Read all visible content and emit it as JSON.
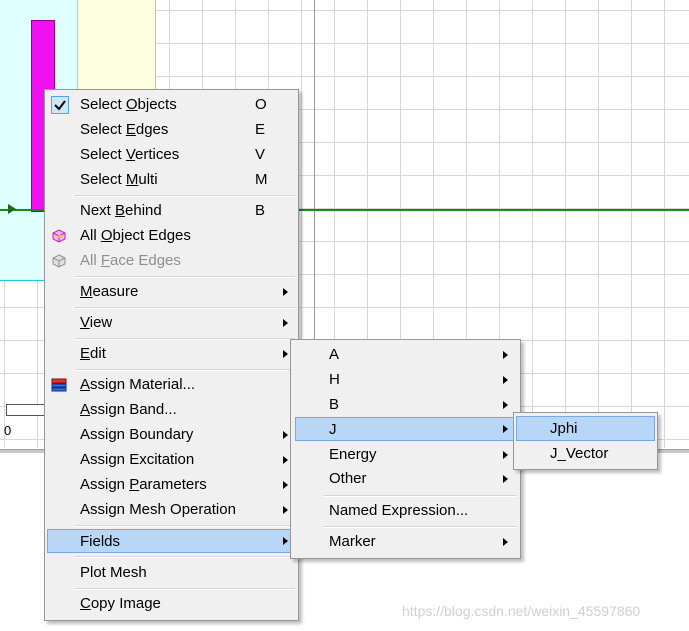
{
  "canvas": {
    "ruler_zero": "0"
  },
  "main_menu": {
    "items": [
      {
        "label": "Select Objects",
        "underline": "O",
        "shortcut": "O",
        "checked": true
      },
      {
        "label": "Select Edges",
        "underline": "E",
        "shortcut": "E"
      },
      {
        "label": "Select Vertices",
        "underline": "V",
        "shortcut": "V"
      },
      {
        "label": "Select Multi",
        "underline": "M",
        "shortcut": "M"
      },
      {
        "label": "Next Behind",
        "underline": "B",
        "shortcut": "B"
      },
      {
        "label": "All Object Edges",
        "underline": "O",
        "icon": "object-edges-icon"
      },
      {
        "label": "All Face Edges",
        "underline": "F",
        "icon": "face-edges-icon",
        "disabled": true
      },
      {
        "label": "Measure",
        "underline": "M",
        "submenu": true
      },
      {
        "label": "View",
        "underline": "V",
        "submenu": true
      },
      {
        "label": "Edit",
        "underline": "E",
        "submenu": true
      },
      {
        "label": "Assign Material...",
        "underline": "A",
        "icon": "material-icon"
      },
      {
        "label": "Assign Band...",
        "underline": "A"
      },
      {
        "label": "Assign Boundary",
        "submenu": true
      },
      {
        "label": "Assign Excitation",
        "submenu": true
      },
      {
        "label": "Assign Parameters",
        "underline": "P",
        "submenu": true
      },
      {
        "label": "Assign Mesh Operation",
        "submenu": true
      },
      {
        "label": "Fields",
        "submenu": true,
        "highlighted": true
      },
      {
        "label": "Plot Mesh"
      },
      {
        "label": "Copy Image",
        "underline": "C"
      }
    ]
  },
  "fields_menu": {
    "items": [
      {
        "label": "A",
        "submenu": true
      },
      {
        "label": "H",
        "submenu": true
      },
      {
        "label": "B",
        "submenu": true
      },
      {
        "label": "J",
        "submenu": true,
        "highlighted": true
      },
      {
        "label": "Energy",
        "submenu": true
      },
      {
        "label": "Other",
        "submenu": true
      },
      {
        "label": "Named Expression..."
      },
      {
        "label": "Marker",
        "submenu": true
      }
    ]
  },
  "j_menu": {
    "items": [
      {
        "label": "Jphi",
        "highlighted": true
      },
      {
        "label": "J_Vector"
      }
    ]
  },
  "watermark": "https://blog.csdn.net/weixin_45597860",
  "colors": {
    "highlight": "#cce8ff",
    "canvas_object": "#f011f0",
    "axis": "#1a8a1a"
  }
}
